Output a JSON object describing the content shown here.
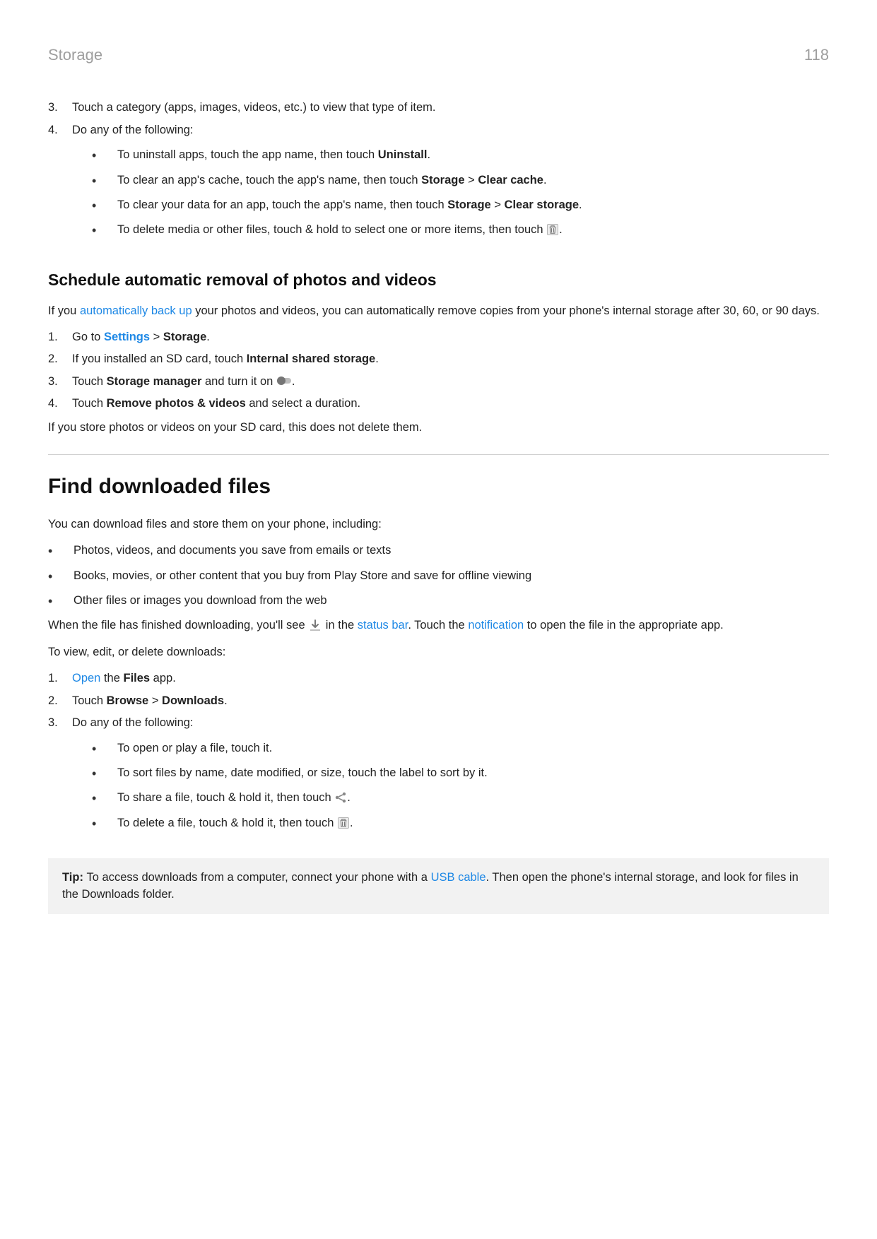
{
  "header": {
    "title": "Storage",
    "page_number": "118"
  },
  "top_steps": {
    "step3_num": "3.",
    "step3_text": "Touch a category (apps, images, videos, etc.) to view that type of item.",
    "step4_num": "4.",
    "step4_text": "Do any of the following:",
    "step4_bullets": {
      "b1a": "To uninstall apps, touch the app name, then touch ",
      "b1b": "Uninstall",
      "b1c": ".",
      "b2a": "To clear an app's cache, touch the app's name, then touch ",
      "b2b": "Storage",
      "b2c": " > ",
      "b2d": "Clear cache",
      "b2e": ".",
      "b3a": "To clear your data for an app, touch the app's name, then touch ",
      "b3b": "Storage",
      "b3c": " > ",
      "b3d": "Clear storage",
      "b3e": ".",
      "b4a": "To delete media or other files, touch & hold to select one or more items, then touch ",
      "b4b": "."
    }
  },
  "section_schedule": {
    "heading": "Schedule automatic removal of photos and videos",
    "p1a": "If you ",
    "p1_link": "automatically back up",
    "p1b": " your photos and videos, you can automatically remove copies from your phone's internal storage after 30, 60, or 90 days.",
    "s1_num": "1.",
    "s1a": "Go to ",
    "s1_link": "Settings",
    "s1b": " > ",
    "s1c": "Storage",
    "s1d": ".",
    "s2_num": "2.",
    "s2a": "If you installed an SD card, touch ",
    "s2b": "Internal shared storage",
    "s2c": ".",
    "s3_num": "3.",
    "s3a": "Touch ",
    "s3b": "Storage manager",
    "s3c": " and turn it on ",
    "s3d": ".",
    "s4_num": "4.",
    "s4a": "Touch ",
    "s4b": "Remove photos & videos",
    "s4c": " and select a duration.",
    "p2": "If you store photos or videos on your SD card, this does not delete them."
  },
  "section_find": {
    "heading": "Find downloaded files",
    "p1": "You can download files and store them on your phone, including:",
    "bullets": {
      "b1": "Photos, videos, and documents you save from emails or texts",
      "b2": "Books, movies, or other content that you buy from Play Store and save for offline viewing",
      "b3": "Other files or images you download from the web"
    },
    "p2a": "When the file has finished downloading, you'll see ",
    "p2b": " in the ",
    "p2_link1": "status bar",
    "p2c": ". Touch the ",
    "p2_link2": "notification",
    "p2d": " to open the file in the appropriate app.",
    "p3": "To view, edit, or delete downloads:",
    "s1_num": "1.",
    "s1_link": "Open",
    "s1a": " the ",
    "s1b": "Files",
    "s1c": " app.",
    "s2_num": "2.",
    "s2a": "Touch ",
    "s2b": "Browse",
    "s2c": " > ",
    "s2d": "Downloads",
    "s2e": ".",
    "s3_num": "3.",
    "s3a": "Do any of the following:",
    "s3_bullets": {
      "b1": "To open or play a file, touch it.",
      "b2": "To sort files by name, date modified, or size, touch the label to sort by it.",
      "b3a": "To share a file, touch & hold it, then touch ",
      "b3b": ".",
      "b4a": "To delete a file, touch & hold it, then touch ",
      "b4b": "."
    }
  },
  "tip": {
    "label": "Tip: ",
    "a": "To access downloads from a computer, connect your phone with a ",
    "link": "USB cable",
    "b": ". Then open the phone's internal storage, and look for files in the Downloads folder."
  }
}
